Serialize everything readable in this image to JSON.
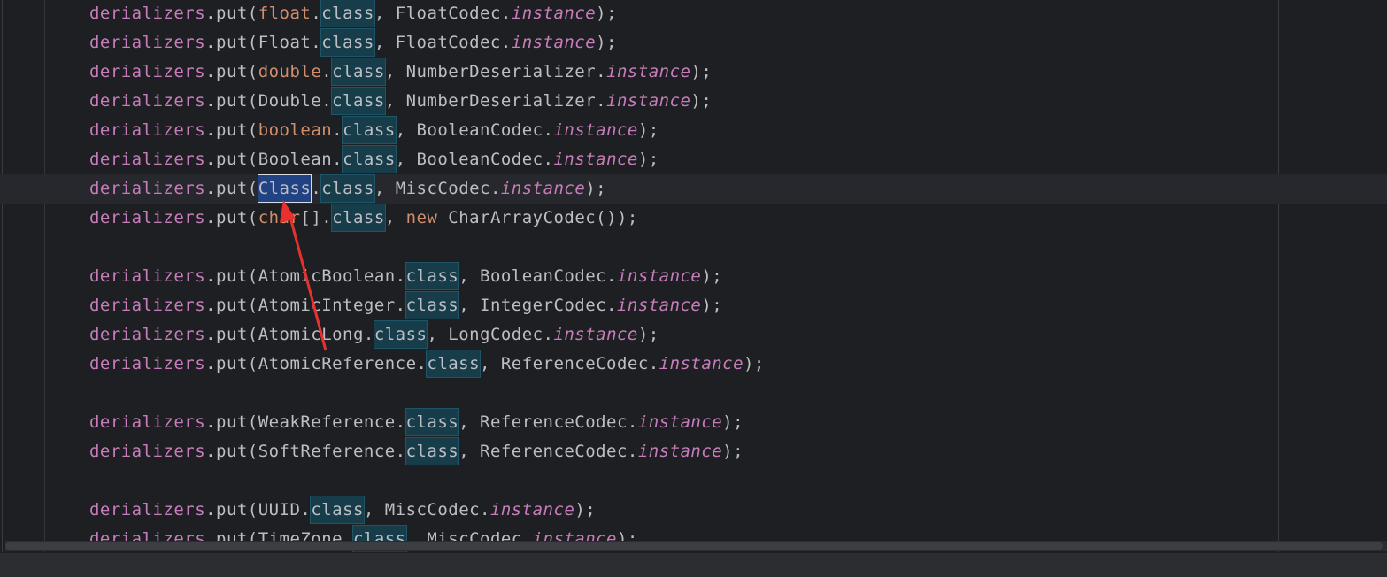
{
  "editor": {
    "language": "java",
    "lines": [
      {
        "tokens": [
          {
            "t": "derializers",
            "k": "id"
          },
          {
            "t": ".put(",
            "k": "p"
          },
          {
            "t": "float",
            "k": "kw"
          },
          {
            "t": ".",
            "k": "p"
          },
          {
            "t": "class",
            "k": "occ"
          },
          {
            "t": ", FloatCodec.",
            "k": "p"
          },
          {
            "t": "instance",
            "k": "it"
          },
          {
            "t": ");",
            "k": "p"
          }
        ]
      },
      {
        "tokens": [
          {
            "t": "derializers",
            "k": "id"
          },
          {
            "t": ".put(Float.",
            "k": "p"
          },
          {
            "t": "class",
            "k": "occ"
          },
          {
            "t": ", FloatCodec.",
            "k": "p"
          },
          {
            "t": "instance",
            "k": "it"
          },
          {
            "t": ");",
            "k": "p"
          }
        ]
      },
      {
        "tokens": [
          {
            "t": "derializers",
            "k": "id"
          },
          {
            "t": ".put(",
            "k": "p"
          },
          {
            "t": "double",
            "k": "kw"
          },
          {
            "t": ".",
            "k": "p"
          },
          {
            "t": "class",
            "k": "occ"
          },
          {
            "t": ", NumberDeserializer.",
            "k": "p"
          },
          {
            "t": "instance",
            "k": "it"
          },
          {
            "t": ");",
            "k": "p"
          }
        ]
      },
      {
        "tokens": [
          {
            "t": "derializers",
            "k": "id"
          },
          {
            "t": ".put(Double.",
            "k": "p"
          },
          {
            "t": "class",
            "k": "occ"
          },
          {
            "t": ", NumberDeserializer.",
            "k": "p"
          },
          {
            "t": "instance",
            "k": "it"
          },
          {
            "t": ");",
            "k": "p"
          }
        ]
      },
      {
        "tokens": [
          {
            "t": "derializers",
            "k": "id"
          },
          {
            "t": ".put(",
            "k": "p"
          },
          {
            "t": "boolean",
            "k": "kw"
          },
          {
            "t": ".",
            "k": "p"
          },
          {
            "t": "class",
            "k": "occ"
          },
          {
            "t": ", BooleanCodec.",
            "k": "p"
          },
          {
            "t": "instance",
            "k": "it"
          },
          {
            "t": ");",
            "k": "p"
          }
        ]
      },
      {
        "tokens": [
          {
            "t": "derializers",
            "k": "id"
          },
          {
            "t": ".put(Boolean.",
            "k": "p"
          },
          {
            "t": "class",
            "k": "occ"
          },
          {
            "t": ", BooleanCodec.",
            "k": "p"
          },
          {
            "t": "instance",
            "k": "it"
          },
          {
            "t": ");",
            "k": "p"
          }
        ]
      },
      {
        "current": true,
        "tokens": [
          {
            "t": "derializers",
            "k": "id"
          },
          {
            "t": ".put(",
            "k": "p"
          },
          {
            "t": "Class",
            "k": "sel"
          },
          {
            "t": ".",
            "k": "p"
          },
          {
            "t": "class",
            "k": "occ"
          },
          {
            "t": ", MiscCodec.",
            "k": "p"
          },
          {
            "t": "instance",
            "k": "it"
          },
          {
            "t": ");",
            "k": "p"
          }
        ]
      },
      {
        "tokens": [
          {
            "t": "derializers",
            "k": "id"
          },
          {
            "t": ".put(",
            "k": "p"
          },
          {
            "t": "char",
            "k": "kw"
          },
          {
            "t": "[].",
            "k": "p"
          },
          {
            "t": "class",
            "k": "occ"
          },
          {
            "t": ", ",
            "k": "p"
          },
          {
            "t": "new",
            "k": "kw"
          },
          {
            "t": " CharArrayCodec());",
            "k": "p"
          }
        ]
      },
      {
        "tokens": []
      },
      {
        "tokens": [
          {
            "t": "derializers",
            "k": "id"
          },
          {
            "t": ".put(AtomicBoolean.",
            "k": "p"
          },
          {
            "t": "class",
            "k": "occ"
          },
          {
            "t": ", BooleanCodec.",
            "k": "p"
          },
          {
            "t": "instance",
            "k": "it"
          },
          {
            "t": ");",
            "k": "p"
          }
        ]
      },
      {
        "tokens": [
          {
            "t": "derializers",
            "k": "id"
          },
          {
            "t": ".put(AtomicInteger.",
            "k": "p"
          },
          {
            "t": "class",
            "k": "occ"
          },
          {
            "t": ", IntegerCodec.",
            "k": "p"
          },
          {
            "t": "instance",
            "k": "it"
          },
          {
            "t": ");",
            "k": "p"
          }
        ]
      },
      {
        "tokens": [
          {
            "t": "derializers",
            "k": "id"
          },
          {
            "t": ".put(AtomicLong.",
            "k": "p"
          },
          {
            "t": "class",
            "k": "occ"
          },
          {
            "t": ", LongCodec.",
            "k": "p"
          },
          {
            "t": "instance",
            "k": "it"
          },
          {
            "t": ");",
            "k": "p"
          }
        ]
      },
      {
        "tokens": [
          {
            "t": "derializers",
            "k": "id"
          },
          {
            "t": ".put(AtomicReference.",
            "k": "p"
          },
          {
            "t": "class",
            "k": "occ"
          },
          {
            "t": ", ReferenceCodec.",
            "k": "p"
          },
          {
            "t": "instance",
            "k": "it"
          },
          {
            "t": ");",
            "k": "p"
          }
        ]
      },
      {
        "tokens": []
      },
      {
        "tokens": [
          {
            "t": "derializers",
            "k": "id"
          },
          {
            "t": ".put(WeakReference.",
            "k": "p"
          },
          {
            "t": "class",
            "k": "occ"
          },
          {
            "t": ", ReferenceCodec.",
            "k": "p"
          },
          {
            "t": "instance",
            "k": "it"
          },
          {
            "t": ");",
            "k": "p"
          }
        ]
      },
      {
        "tokens": [
          {
            "t": "derializers",
            "k": "id"
          },
          {
            "t": ".put(SoftReference.",
            "k": "p"
          },
          {
            "t": "class",
            "k": "occ"
          },
          {
            "t": ", ReferenceCodec.",
            "k": "p"
          },
          {
            "t": "instance",
            "k": "it"
          },
          {
            "t": ");",
            "k": "p"
          }
        ]
      },
      {
        "tokens": []
      },
      {
        "tokens": [
          {
            "t": "derializers",
            "k": "id"
          },
          {
            "t": ".put(UUID.",
            "k": "p"
          },
          {
            "t": "class",
            "k": "occ"
          },
          {
            "t": ", MiscCodec.",
            "k": "p"
          },
          {
            "t": "instance",
            "k": "it"
          },
          {
            "t": ");",
            "k": "p"
          }
        ]
      },
      {
        "tokens": [
          {
            "t": "derializers",
            "k": "id"
          },
          {
            "t": ".put(TimeZone.",
            "k": "p"
          },
          {
            "t": "class",
            "k": "occ"
          },
          {
            "t": ", MiscCodec.",
            "k": "p"
          },
          {
            "t": "instance",
            "k": "it"
          },
          {
            "t": ");",
            "k": "p"
          }
        ]
      }
    ]
  },
  "colors": {
    "background": "#1e1f22",
    "current_line": "#26282e",
    "identifier": "#c77dbb",
    "keyword": "#cf8e6d",
    "plain": "#bcbec4",
    "occurrence_highlight": "#173d4a",
    "selection": "#214283",
    "annotation_arrow": "#e8312f"
  },
  "annotation": {
    "type": "arrow",
    "color": "#e8312f",
    "points_to": "Class"
  }
}
